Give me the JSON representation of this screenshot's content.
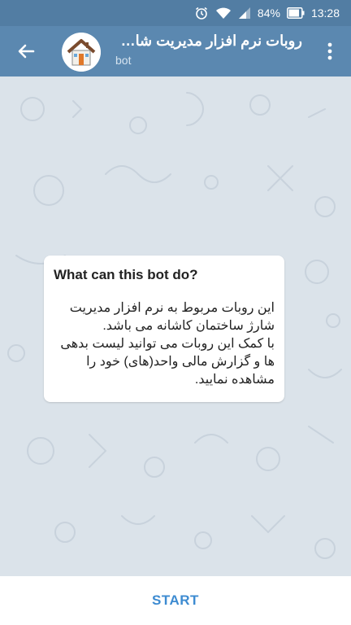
{
  "status_bar": {
    "battery_percent": "84%",
    "time": "13:28",
    "icons": [
      "alarm-icon",
      "wifi-icon",
      "signal-icon",
      "battery-icon"
    ]
  },
  "header": {
    "title": "روبات نرم افزار مدیریت شارژ ساختمان",
    "subtitle": "bot",
    "back_icon": "arrow-left-icon",
    "menu_icon": "more-vert-icon",
    "avatar_icon": "house-icon"
  },
  "bot_card": {
    "title": "What can this bot do?",
    "body": "این روبات مربوط به نرم افزار مدیریت شارژ ساختمان کاشانه می باشد.\nبا کمک این روبات می توانید لیست بدهی ها و گزارش مالی واحد(های) خود را مشاهده نمایید."
  },
  "footer": {
    "start_label": "START"
  },
  "colors": {
    "status_bar": "#527da3",
    "app_bar": "#5b88b0",
    "chat_background": "#dbe3ea",
    "accent": "#3d8bd1"
  }
}
